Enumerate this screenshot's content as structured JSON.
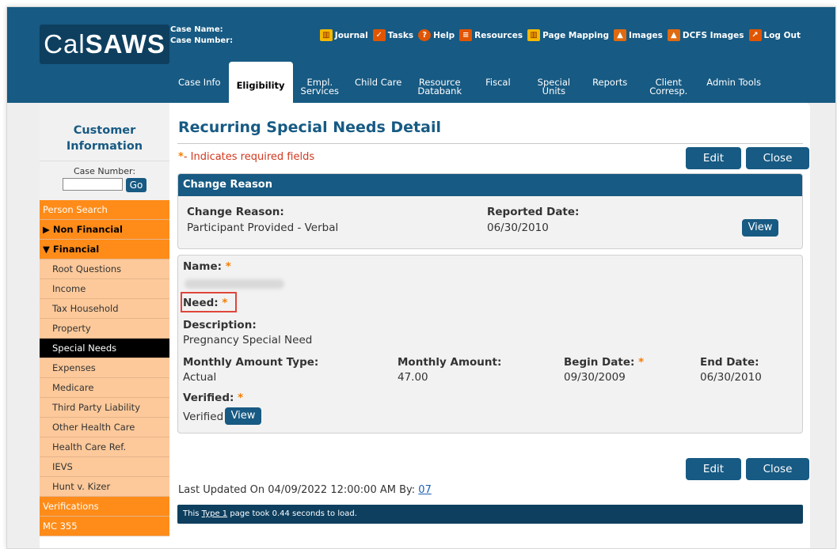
{
  "header": {
    "logo_text_plain": "Cal",
    "logo_text_bold": "SAWS",
    "case_name_label": "Case Name:",
    "case_number_label": "Case Number:",
    "util_links": [
      {
        "label": "Journal",
        "icon": "book-icon"
      },
      {
        "label": "Tasks",
        "icon": "checkbox-icon"
      },
      {
        "label": "Help",
        "icon": "help-icon"
      },
      {
        "label": "Resources",
        "icon": "resources-icon"
      },
      {
        "label": "Page Mapping",
        "icon": "map-icon"
      },
      {
        "label": "Images",
        "icon": "image-icon"
      },
      {
        "label": "DCFS Images",
        "icon": "image-icon"
      },
      {
        "label": "Log Out",
        "icon": "logout-icon"
      }
    ],
    "tabs": [
      {
        "line1": "Case Info",
        "line2": ""
      },
      {
        "line1": "Eligibility",
        "line2": "",
        "active": true
      },
      {
        "line1": "Empl.",
        "line2": "Services"
      },
      {
        "line1": "Child Care",
        "line2": ""
      },
      {
        "line1": "Resource",
        "line2": "Databank"
      },
      {
        "line1": "Fiscal",
        "line2": ""
      },
      {
        "line1": "Special",
        "line2": "Units"
      },
      {
        "line1": "Reports",
        "line2": ""
      },
      {
        "line1": "Client",
        "line2": "Corresp."
      },
      {
        "line1": "Admin Tools",
        "line2": ""
      }
    ]
  },
  "sidebar": {
    "title_line1": "Customer",
    "title_line2": "Information",
    "case_number_label": "Case Number:",
    "go_label": "Go",
    "items": [
      {
        "label": "Person Search",
        "level": "l1"
      },
      {
        "label": "▶ Non Financial",
        "level": "l1b"
      },
      {
        "label": "▼ Financial",
        "level": "l1b"
      },
      {
        "label": "Root Questions",
        "level": "l2"
      },
      {
        "label": "Income",
        "level": "l2"
      },
      {
        "label": "Tax Household",
        "level": "l2"
      },
      {
        "label": "Property",
        "level": "l2"
      },
      {
        "label": "Special Needs",
        "level": "sel"
      },
      {
        "label": "Expenses",
        "level": "l2"
      },
      {
        "label": "Medicare",
        "level": "l2"
      },
      {
        "label": "Third Party Liability",
        "level": "l2"
      },
      {
        "label": "Other Health Care",
        "level": "l2"
      },
      {
        "label": "Health Care Ref.",
        "level": "l2"
      },
      {
        "label": "IEVS",
        "level": "l2"
      },
      {
        "label": "Hunt v. Kizer",
        "level": "l2"
      },
      {
        "label": "Verifications",
        "level": "l1"
      },
      {
        "label": "MC 355",
        "level": "l1"
      }
    ]
  },
  "main": {
    "title": "Recurring Special Needs Detail",
    "required_star": "*",
    "required_note": "- Indicates required fields",
    "edit_label": "Edit",
    "close_label": "Close",
    "change_reason": {
      "header": "Change Reason",
      "reason_label": "Change Reason:",
      "reason_value": "Participant Provided - Verbal",
      "reported_label": "Reported Date:",
      "reported_value": "06/30/2010",
      "view_label": "View"
    },
    "detail": {
      "name_label": "Name:",
      "need_label": "Need:",
      "description_label": "Description:",
      "description_value": "Pregnancy Special Need",
      "monthly_type_label": "Monthly Amount Type:",
      "monthly_type_value": "Actual",
      "monthly_amount_label": "Monthly Amount:",
      "monthly_amount_value": "47.00",
      "begin_label": "Begin Date:",
      "begin_value": "09/30/2009",
      "end_label": "End Date:",
      "end_value": "06/30/2010",
      "verified_label": "Verified:",
      "verified_value": "Verified",
      "view_label": "View"
    },
    "last_updated_prefix": "Last Updated On 04/09/2022 12:00:00 AM By:",
    "last_updated_by": "07",
    "load_prefix": "This",
    "load_link": "Type 1",
    "load_suffix": "page took 0.44 seconds to load."
  }
}
